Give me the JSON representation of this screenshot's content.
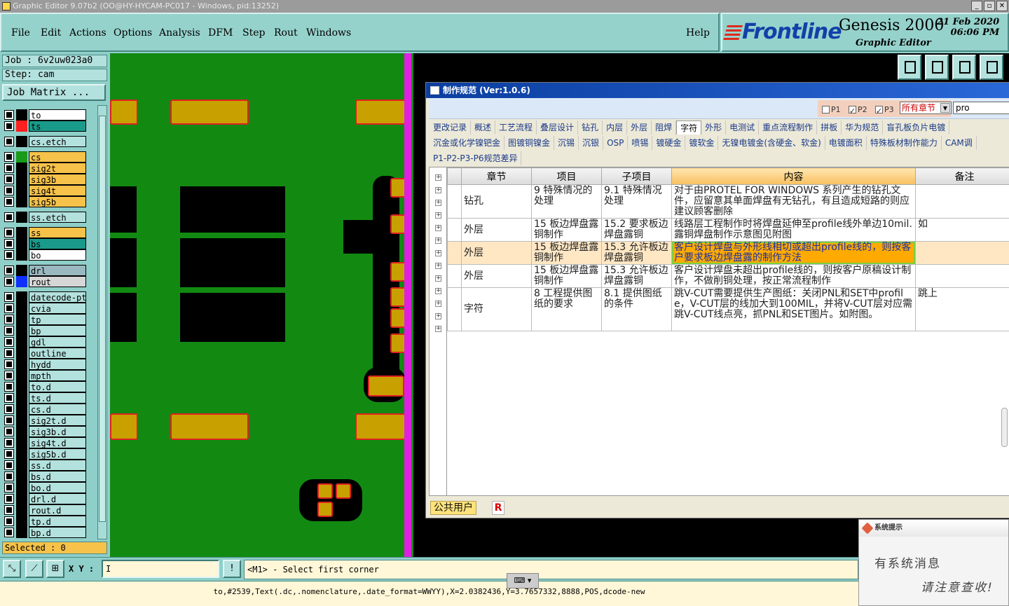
{
  "window": {
    "title": "Graphic Editor 9.07b2 (OO@HY-HYCAM-PC017 - Windows, pid:13252)"
  },
  "menu": {
    "items": [
      "File",
      "Edit",
      "Actions",
      "Options",
      "Analysis",
      "DFM",
      "Step",
      "Rout",
      "Windows"
    ],
    "help": "Help"
  },
  "brand": {
    "logo": "Frontline",
    "product": "Genesis 2000",
    "subtitle": "Graphic Editor",
    "date": "21 Feb 2020",
    "time": "06:06 PM"
  },
  "job": {
    "job_line": "Job  : 6v2uw023a0",
    "step_line": "Step: cam",
    "matrix_button": "Job Matrix ..."
  },
  "layers": [
    {
      "name": "to",
      "color": "#000000",
      "fill": "#ffffff"
    },
    {
      "name": "ts",
      "color": "#ff2020",
      "fill": "#1a9a8a"
    },
    {
      "name": "cs.etch",
      "color": "#000000",
      "fill": "#b3e1dd"
    },
    {
      "name": "cs",
      "color": "#1a9a1a",
      "fill": "#f6c24a"
    },
    {
      "name": "sig2t",
      "color": "#000000",
      "fill": "#f6c24a"
    },
    {
      "name": "sig3b",
      "color": "#000000",
      "fill": "#f6c24a"
    },
    {
      "name": "sig4t",
      "color": "#000000",
      "fill": "#f6c24a"
    },
    {
      "name": "sig5b",
      "color": "#000000",
      "fill": "#f6c24a"
    },
    {
      "name": "ss.etch",
      "color": "#000000",
      "fill": "#b3e1dd"
    },
    {
      "name": "ss",
      "color": "#000000",
      "fill": "#f6c24a"
    },
    {
      "name": "bs",
      "color": "#000000",
      "fill": "#1a9a8a"
    },
    {
      "name": "bo",
      "color": "#000000",
      "fill": "#ffffff"
    },
    {
      "name": "drl",
      "color": "#000000",
      "fill": "#9ab8c0"
    },
    {
      "name": "rout",
      "color": "#1030ff",
      "fill": "#d6d6d6"
    },
    {
      "name": "datecode-pt",
      "color": "#000000",
      "fill": "#b3e1dd"
    },
    {
      "name": "cvia",
      "color": "#000000",
      "fill": "#b3e1dd"
    },
    {
      "name": "tp",
      "color": "#000000",
      "fill": "#b3e1dd"
    },
    {
      "name": "bp",
      "color": "#000000",
      "fill": "#b3e1dd"
    },
    {
      "name": "gdl",
      "color": "#000000",
      "fill": "#b3e1dd"
    },
    {
      "name": "outline",
      "color": "#000000",
      "fill": "#b3e1dd"
    },
    {
      "name": "hydd",
      "color": "#000000",
      "fill": "#b3e1dd"
    },
    {
      "name": "mpth",
      "color": "#000000",
      "fill": "#b3e1dd"
    },
    {
      "name": "to.d",
      "color": "#000000",
      "fill": "#b3e1dd"
    },
    {
      "name": "ts.d",
      "color": "#000000",
      "fill": "#b3e1dd"
    },
    {
      "name": "cs.d",
      "color": "#000000",
      "fill": "#b3e1dd"
    },
    {
      "name": "sig2t.d",
      "color": "#000000",
      "fill": "#b3e1dd"
    },
    {
      "name": "sig3b.d",
      "color": "#000000",
      "fill": "#b3e1dd"
    },
    {
      "name": "sig4t.d",
      "color": "#000000",
      "fill": "#b3e1dd"
    },
    {
      "name": "sig5b.d",
      "color": "#000000",
      "fill": "#b3e1dd"
    },
    {
      "name": "ss.d",
      "color": "#000000",
      "fill": "#b3e1dd"
    },
    {
      "name": "bs.d",
      "color": "#000000",
      "fill": "#b3e1dd"
    },
    {
      "name": "bo.d",
      "color": "#000000",
      "fill": "#b3e1dd"
    },
    {
      "name": "drl.d",
      "color": "#000000",
      "fill": "#b3e1dd"
    },
    {
      "name": "rout.d",
      "color": "#000000",
      "fill": "#b3e1dd"
    },
    {
      "name": "tp.d",
      "color": "#000000",
      "fill": "#b3e1dd"
    },
    {
      "name": "bp.d",
      "color": "#000000",
      "fill": "#b3e1dd"
    }
  ],
  "selected_text": "Selected : 0",
  "dialog": {
    "title": "制作规范 (Ver:1.0.6)",
    "filters": {
      "p1": "P1",
      "p2": "P2",
      "p3": "P3",
      "chapter_select": "所有章节",
      "search_value": "pro"
    },
    "tabs_row1": [
      "更改记录",
      "概述",
      "工艺流程",
      "叠层设计",
      "钻孔",
      "内层",
      "外层",
      "阻焊",
      "字符",
      "外形",
      "电测试",
      "重点流程制作",
      "拼板",
      "华为规范",
      "盲孔板负片电镀"
    ],
    "active_tab": "字符",
    "tabs_row2": [
      "沉金或化学镍钯金",
      "图镀铜镍金",
      "沉锡",
      "沉银",
      "OSP",
      "喷锡",
      "镀硬金",
      "镀软金",
      "无镍电镀金(含硬金、软金)",
      "电镀面积",
      "特殊板材制作能力",
      "CAM调"
    ],
    "tabs_row3": [
      "P1-P2-P3-P6规范差异"
    ],
    "columns": [
      "章节",
      "项目",
      "子项目",
      "内容",
      "备注"
    ],
    "rows": [
      {
        "chapter": "钻孔",
        "item": "9 特殊情况的处理",
        "sub": "9.1 特殊情况处理",
        "content": "对于由PROTEL FOR WINDOWS 系列产生的钻孔文件，应留意其单面焊盘有无钻孔，有且造成短路的则应建议顾客删除",
        "note": ""
      },
      {
        "chapter": "外层",
        "item": "15 板边焊盘露铜制作",
        "sub": "15.2 要求板边焊盘露铜",
        "content": "线路层工程制作时将焊盘延伸至profile线外单边10mil.露铜焊盘制作示意图见附图",
        "note": "如"
      },
      {
        "chapter": "外层",
        "item": "15 板边焊盘露铜制作",
        "sub": "15.3 允许板边焊盘露铜",
        "content": "客户设计焊盘与外形线相切或超出profile线的，则按客户要求板边焊盘露的制作方法",
        "note": ""
      },
      {
        "chapter": "外层",
        "item": "15 板边焊盘露铜制作",
        "sub": "15.3 允许板边焊盘露铜",
        "content": "客户设计焊盘未超出profile线的，则按客户原稿设计制作，不做削铜处理，按正常流程制作",
        "note": ""
      },
      {
        "chapter": "字符",
        "item": "8 工程提供图纸的要求",
        "sub": "8.1 提供图纸的条件",
        "content": "跳V-CUT需要提供生产图纸：关闭PNL和SET中profile，V-CUT层的线加大到100MIL，并将V-CUT层对应需跳V-CUT线点亮，抓PNL和SET图片。如附图。",
        "note": "跳上"
      }
    ],
    "footer_user": "公共用户",
    "footer_r": "R"
  },
  "cmd": {
    "xy_label": "X Y :",
    "xy_value": "I",
    "prompt": "<M1> - Select first corner"
  },
  "status": "to,#2539,Text(.dc,.nomenclature,.date_format=WWYY),X=2.0382436,Y=3.7657332,8888,POS,dcode-new",
  "toast": {
    "title": "系统提示",
    "line1": "有系统消息",
    "line2": "请注意查收!"
  }
}
